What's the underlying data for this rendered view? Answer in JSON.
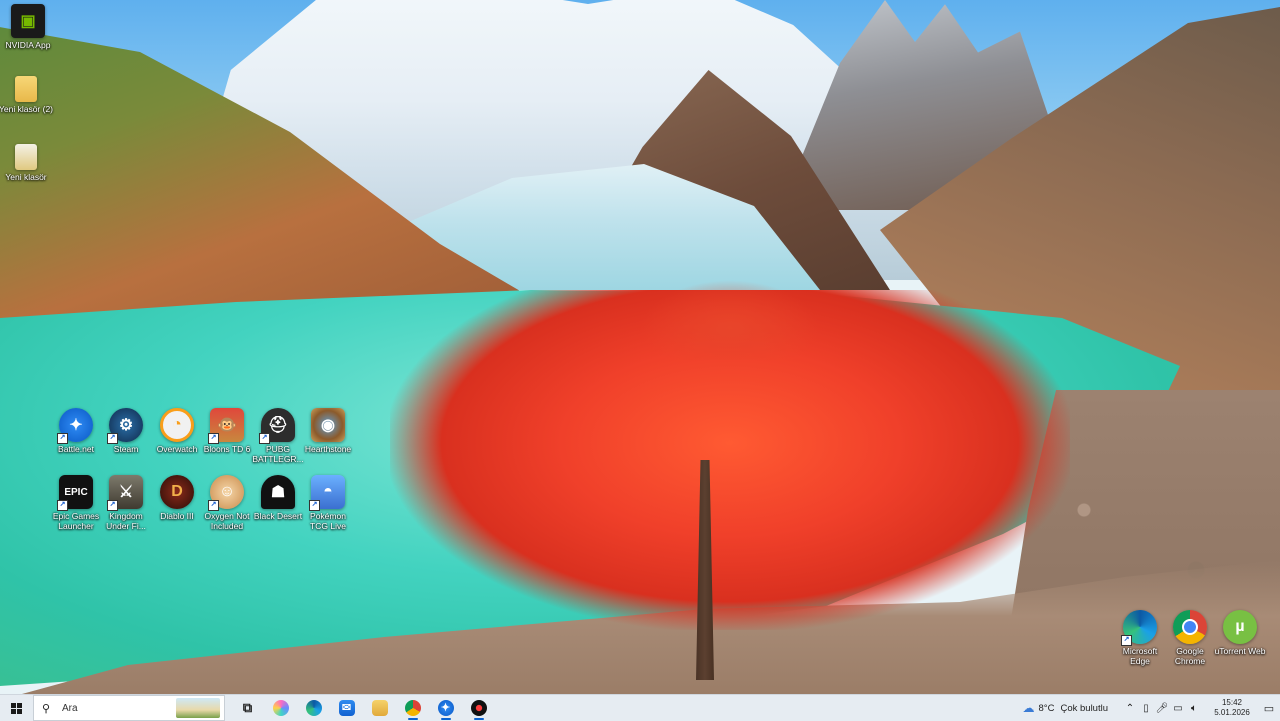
{
  "desktop": {
    "icons": [
      {
        "label": "NVIDIA App",
        "icon": "nvidia-icon",
        "glyph": "▣"
      },
      {
        "label": "Yeni klasör (2)",
        "icon": "folder-icon",
        "glyph": ""
      },
      {
        "label": "Yeni klasör",
        "icon": "folder-icon",
        "glyph": ""
      },
      {
        "label": "Battle.net",
        "icon": "battlenet-icon",
        "glyph": "✦"
      },
      {
        "label": "Steam",
        "icon": "steam-icon",
        "glyph": "⚙"
      },
      {
        "label": "Overwatch",
        "icon": "overwatch-icon",
        "glyph": "◔"
      },
      {
        "label": "Bloons TD 6",
        "icon": "bloons-td6-icon",
        "glyph": "🐵"
      },
      {
        "label": "PUBG BATTLEGR...",
        "icon": "pubg-icon",
        "glyph": "⛑"
      },
      {
        "label": "Hearthstone",
        "icon": "hearthstone-icon",
        "glyph": "◉"
      },
      {
        "label": "Epic Games Launcher",
        "icon": "epic-games-icon",
        "glyph": "EPIC"
      },
      {
        "label": "Kingdom Under Fi...",
        "icon": "kingdom-under-fire-icon",
        "glyph": "⚔"
      },
      {
        "label": "Diablo III",
        "icon": "diablo-icon",
        "glyph": "D"
      },
      {
        "label": "Oxygen Not Included",
        "icon": "oxygen-not-included-icon",
        "glyph": "☺"
      },
      {
        "label": "Black Desert",
        "icon": "black-desert-icon",
        "glyph": "☗"
      },
      {
        "label": "Pokémon TCG Live",
        "icon": "pokemon-tcg-icon",
        "glyph": "◓"
      },
      {
        "label": "Microsoft Edge",
        "icon": "edge-icon",
        "glyph": ""
      },
      {
        "label": "Google Chrome",
        "icon": "chrome-icon",
        "glyph": ""
      },
      {
        "label": "uTorrent Web",
        "icon": "utorrent-icon",
        "glyph": "µ"
      }
    ]
  },
  "taskbar": {
    "search_placeholder": "Ara",
    "apps": [
      "task-view",
      "copilot",
      "edge",
      "outlook",
      "file-explorer",
      "chrome",
      "battlenet",
      "app"
    ],
    "weather": {
      "temp": "8°C",
      "condition": "Çok bulutlu"
    },
    "clock": {
      "time": "15:42",
      "date": "5.01.2026"
    },
    "accent": "#0a62d0"
  }
}
